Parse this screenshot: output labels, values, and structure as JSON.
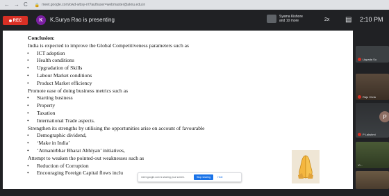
{
  "browser": {
    "nav_icons": [
      "←",
      "→",
      "C"
    ],
    "url": "meet.google.com/owd-wbsy-rrt?authuser=webmaster@aknu.edu.in"
  },
  "meet_bar": {
    "rec_label": "REC",
    "presenter_initial": "K",
    "presenter_text": "K.Surya Rao is presenting",
    "participants_text": "Syama Kishore and 10 more",
    "layout_label": "2x",
    "time": "2:10 PM"
  },
  "slide": {
    "heading": "Conclusion:",
    "lines": [
      {
        "type": "text",
        "text": "India is expected to improve the Global Competitiveness parameters such as"
      },
      {
        "type": "bullet",
        "text": "ICT adoption"
      },
      {
        "type": "bullet",
        "text": "Health conditions"
      },
      {
        "type": "bullet",
        "text": "Upgradation of Skills"
      },
      {
        "type": "bullet",
        "text": "Labour Market conditions"
      },
      {
        "type": "bullet",
        "text": "Product Market efficiency"
      },
      {
        "type": "text",
        "text": "Promote ease of doing business metrics such as"
      },
      {
        "type": "bullet",
        "text": "Starting business"
      },
      {
        "type": "bullet",
        "text": "Property"
      },
      {
        "type": "bullet",
        "text": "Taxation"
      },
      {
        "type": "bullet",
        "text": "International Trade aspects."
      },
      {
        "type": "text",
        "text": "Strengthen its strengths by utilising the opportunities arise on account of favourable"
      },
      {
        "type": "bullet",
        "text": "Demographic dividend,"
      },
      {
        "type": "bullet",
        "text": "‘Make in India’"
      },
      {
        "type": "bullet",
        "text": "‘Atmanirbhar Bharat Abhiyan’ initiatives,"
      },
      {
        "type": "text",
        "text": "Attempt to weaken the pointed-out weaknesses such as"
      },
      {
        "type": "bullet",
        "text": "Reduction of Corruption"
      },
      {
        "type": "bullet",
        "text": "Encouraging Foreign Capital flows inclu"
      }
    ],
    "emoji_icon": "folded-hands-icon"
  },
  "share_bar": {
    "text": "meet.google.com is sharing your screen.",
    "stop_label": "Stop sharing",
    "hide_label": "Hide"
  },
  "side_tiles": [
    {
      "name": "Uppada Su"
    },
    {
      "name": "Raju Chrla"
    },
    {
      "name": "P Lakshmi"
    },
    {
      "name": "Vi..."
    }
  ],
  "side_avatar_initial": "P",
  "colors": {
    "rec": "#d93025",
    "accent": "#1a73e8",
    "meet_bg": "#202124"
  }
}
